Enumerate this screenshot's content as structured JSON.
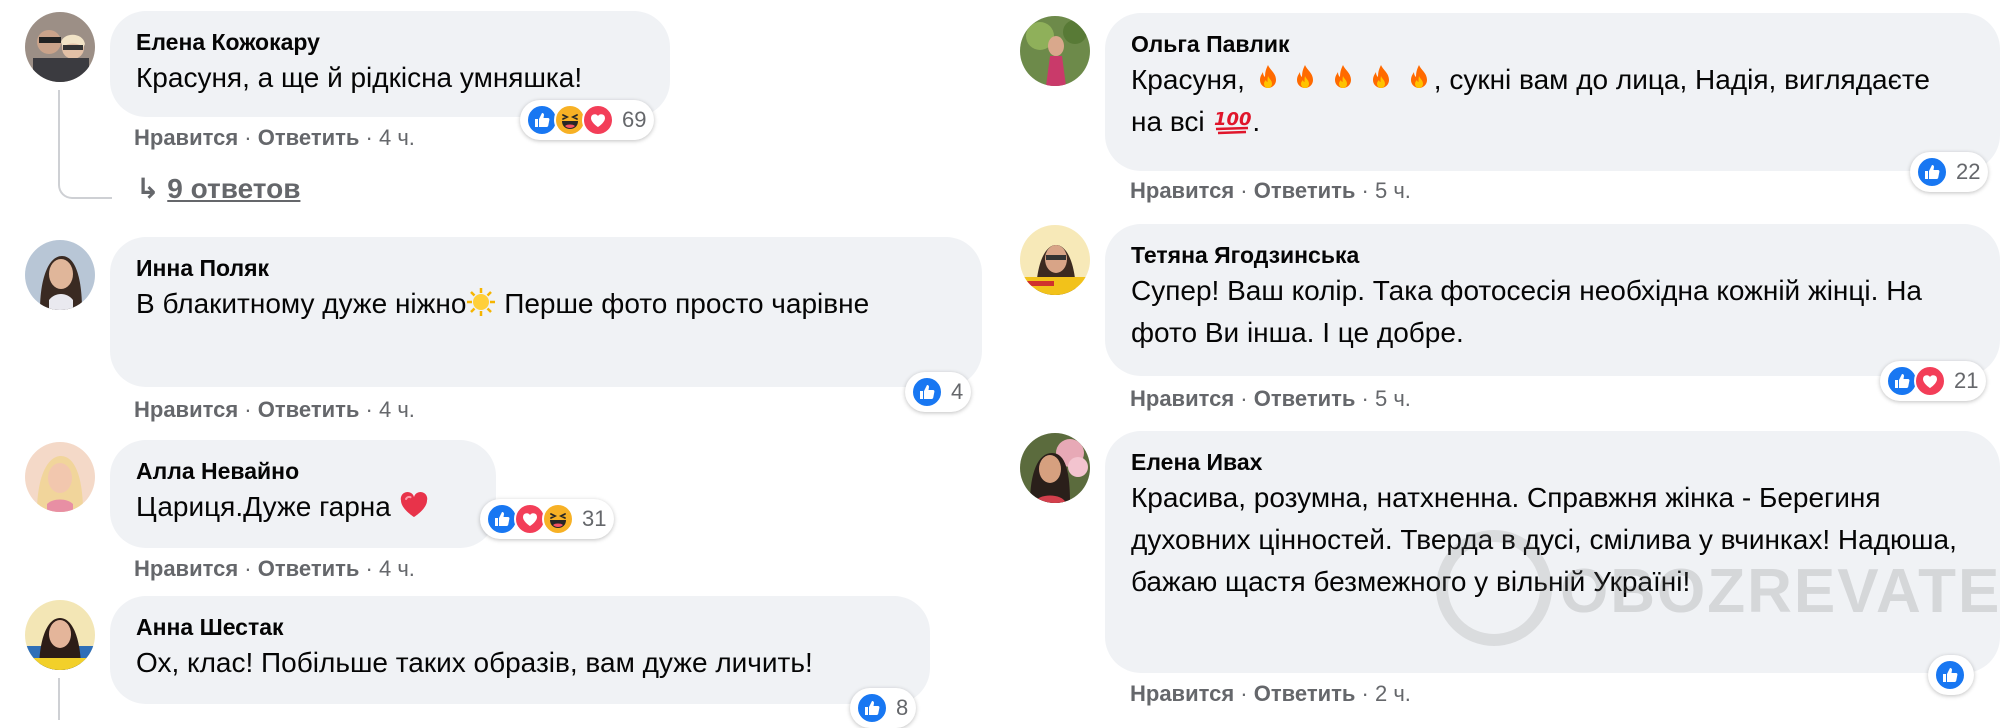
{
  "actions": {
    "like": "Нравится",
    "reply": "Ответить",
    "sep": "·"
  },
  "colors": {
    "bubble": "#f0f2f5",
    "meta": "#65676b",
    "like_blue": "#1877f2",
    "love_red": "#f33e58",
    "haha_yellow": "#f7b125"
  },
  "left": [
    {
      "name": "Елена Кожокару",
      "text": "Красуня, а ще й рідкісна умняшка!",
      "time": "4 ч.",
      "reactions": [
        "like",
        "haha",
        "love"
      ],
      "count": "69",
      "replies": "9 ответов"
    },
    {
      "name": "Инна Поляк",
      "text_a": "В блакитному дуже ніжно",
      "text_b": " Перше фото просто чарівне",
      "time": "4 ч.",
      "reactions": [
        "like"
      ],
      "count": "4"
    },
    {
      "name": "Алла Невайно",
      "text": "Цариця.Дуже гарна ",
      "time": "4 ч.",
      "reactions": [
        "like",
        "love",
        "haha"
      ],
      "count": "31"
    },
    {
      "name": "Анна Шестак",
      "text": "Ох, клас! Побільше таких образів, вам дуже личить!",
      "reactions": [
        "like"
      ],
      "count": "8"
    }
  ],
  "right": [
    {
      "name": "Ольга Павлик",
      "text_a": "Красуня, ",
      "text_b": ", сукні вам до лица, Надія, виглядаєте на всі ",
      "time": "5 ч.",
      "reactions": [
        "like"
      ],
      "count": "22"
    },
    {
      "name": "Тетяна Ягодзинська",
      "text": "Супер! Ваш колір. Така фотосесія необхідна кожній жінці. На фото Ви інша. І це добре.",
      "time": "5 ч.",
      "reactions": [
        "like",
        "love"
      ],
      "count": "21"
    },
    {
      "name": "Елена Ивах",
      "text": "Красива, розумна, натхненна. Справжня жінка - Берегиня духовних цінностей. Тверда в дусі, смілива у вчинках! Надюша, бажаю щастя безмежного у вільній Україні!",
      "time": "2 ч.",
      "reactions": [
        "like"
      ],
      "count": ""
    }
  ],
  "watermark": "OBOZREVATEL"
}
